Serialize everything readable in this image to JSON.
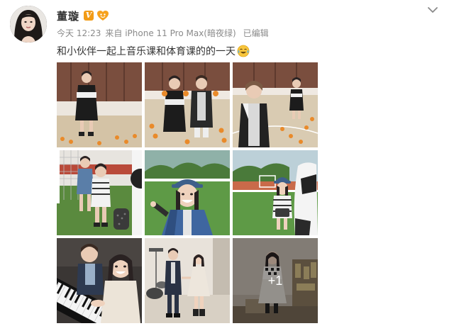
{
  "post": {
    "author": {
      "name": "董璇",
      "vip_badge": "V",
      "avatar_icon": "avatar-photo"
    },
    "meta": {
      "time": "今天 12:23",
      "source": "来自 iPhone 11 Pro Max(暗夜绿)",
      "edited": "已编辑"
    },
    "text": "和小伙伴一起上音乐课和体育课的的一天",
    "text_emoji": "laughing-tears-emoji",
    "menu_icon": "chevron-down-icon",
    "photos": [
      {
        "name": "photo-1",
        "scene": "girl-dress-gym"
      },
      {
        "name": "photo-2",
        "scene": "two-kids-oranges"
      },
      {
        "name": "photo-3",
        "scene": "two-kids-gym-wide"
      },
      {
        "name": "photo-4",
        "scene": "kids-soccer-goal"
      },
      {
        "name": "photo-5",
        "scene": "girl-cap-field"
      },
      {
        "name": "photo-6",
        "scene": "girl-cap-soccer-ball"
      },
      {
        "name": "photo-7",
        "scene": "kids-piano"
      },
      {
        "name": "photo-8",
        "scene": "kids-holding-hands"
      },
      {
        "name": "photo-9",
        "scene": "girl-room-more",
        "more_label": "+1"
      }
    ]
  },
  "colors": {
    "username": "#333333",
    "meta": "#8a8a8a",
    "vip": "#f29b16"
  }
}
